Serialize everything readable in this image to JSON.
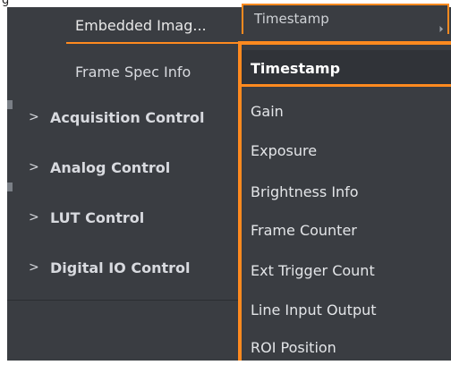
{
  "tree": {
    "rows": [
      {
        "label": "Embedded Imag..."
      },
      {
        "label": "Frame Spec Info"
      },
      {
        "label": "Acquisition Control",
        "chevron": ">"
      },
      {
        "label": "Analog Control",
        "chevron": ">"
      },
      {
        "label": "LUT Control",
        "chevron": ">"
      },
      {
        "label": "Digital IO Control",
        "chevron": ">"
      }
    ]
  },
  "combo": {
    "value": "Timestamp"
  },
  "dropdown": {
    "selected": "Timestamp",
    "options": [
      "Timestamp",
      "Gain",
      "Exposure",
      "Brightness Info",
      "Frame Counter",
      "Ext Trigger Count",
      "Line Input Output",
      "ROI Position"
    ]
  },
  "colors": {
    "panel_bg": "#3a3d42",
    "accent": "#ff8a1f",
    "text": "#d8dadf"
  }
}
